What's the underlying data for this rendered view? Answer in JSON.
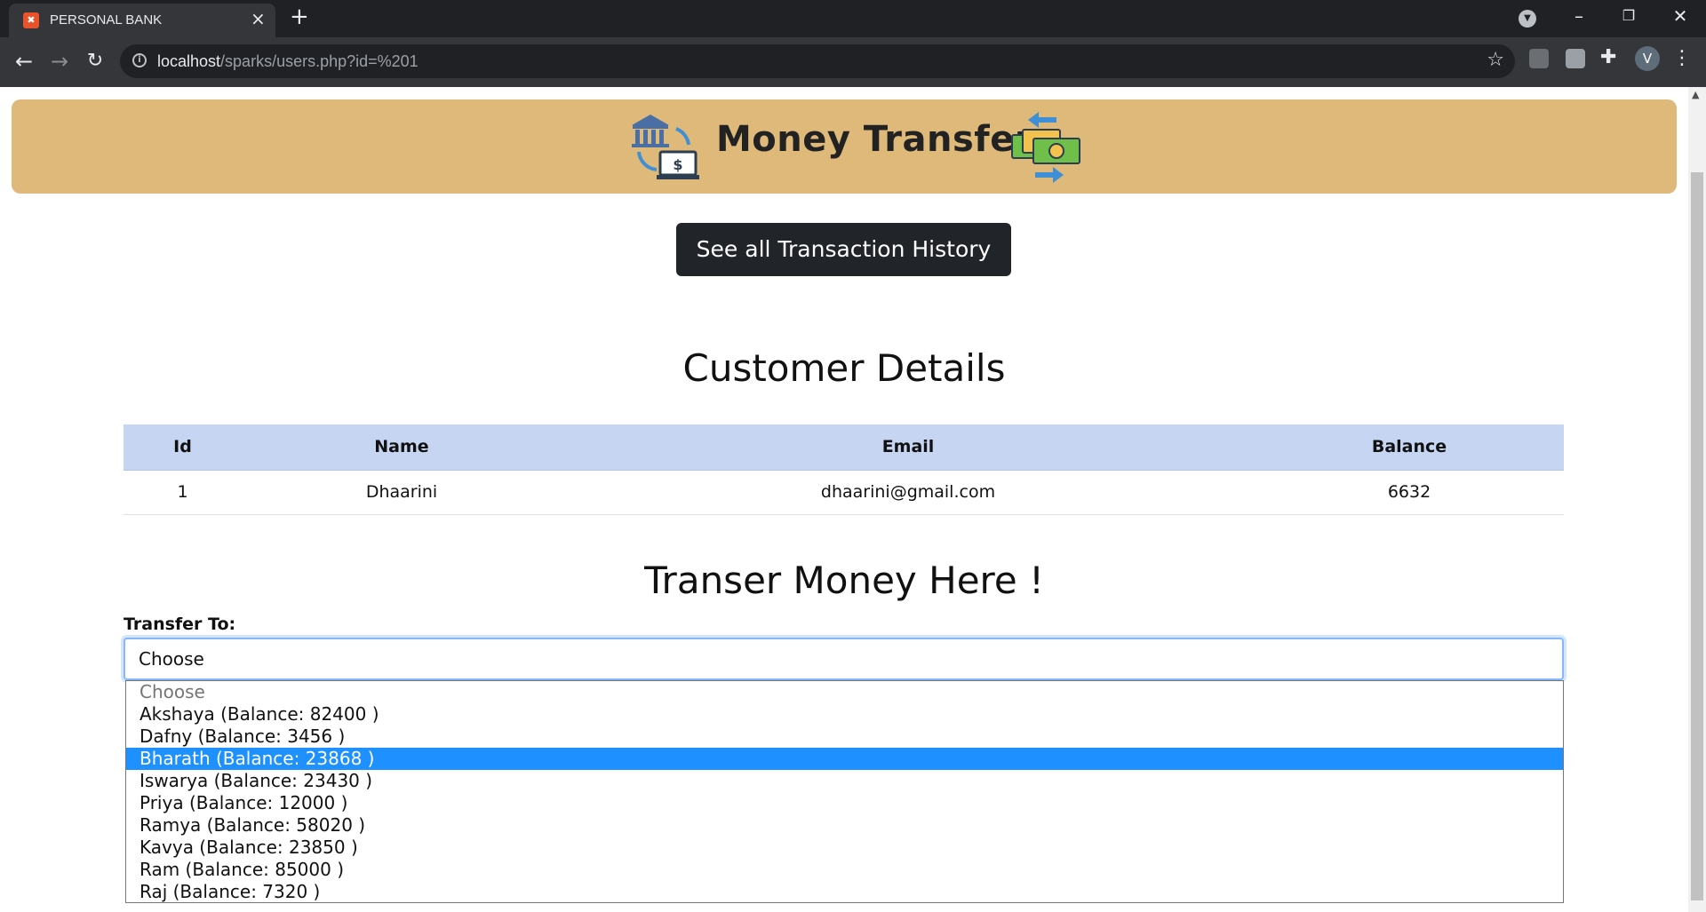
{
  "browser": {
    "tab_title": "PERSONAL BANK",
    "url_host": "localhost",
    "url_path": "/sparks/users.php?id=%201",
    "profile_initial": "V"
  },
  "banner": {
    "title": "Money Transfer"
  },
  "history_button": "See all Transaction History",
  "customer_section": {
    "title": "Customer Details",
    "columns": [
      "Id",
      "Name",
      "Email",
      "Balance"
    ],
    "row": {
      "id": "1",
      "name": "Dhaarini",
      "email": "dhaarini@gmail.com",
      "balance": "6632"
    }
  },
  "transfer_section": {
    "title": "Transer Money Here !",
    "label": "Transfer To:",
    "select_value": "Choose",
    "options": [
      "Choose",
      "Akshaya (Balance: 82400 )",
      "Dafny (Balance: 3456 )",
      "Bharath (Balance: 23868 )",
      "Iswarya (Balance: 23430 )",
      "Priya (Balance: 12000 )",
      "Ramya (Balance: 58020 )",
      "Kavya (Balance: 23850 )",
      "Ram (Balance: 85000 )",
      "Raj (Balance: 7320 )"
    ],
    "highlighted_option": "Bharath (Balance: 23868 )"
  },
  "colors": {
    "banner_bg": "#deb97a",
    "table_header_bg": "#c6d5f2",
    "button_bg": "#212529",
    "option_highlight": "#1e90ff"
  }
}
